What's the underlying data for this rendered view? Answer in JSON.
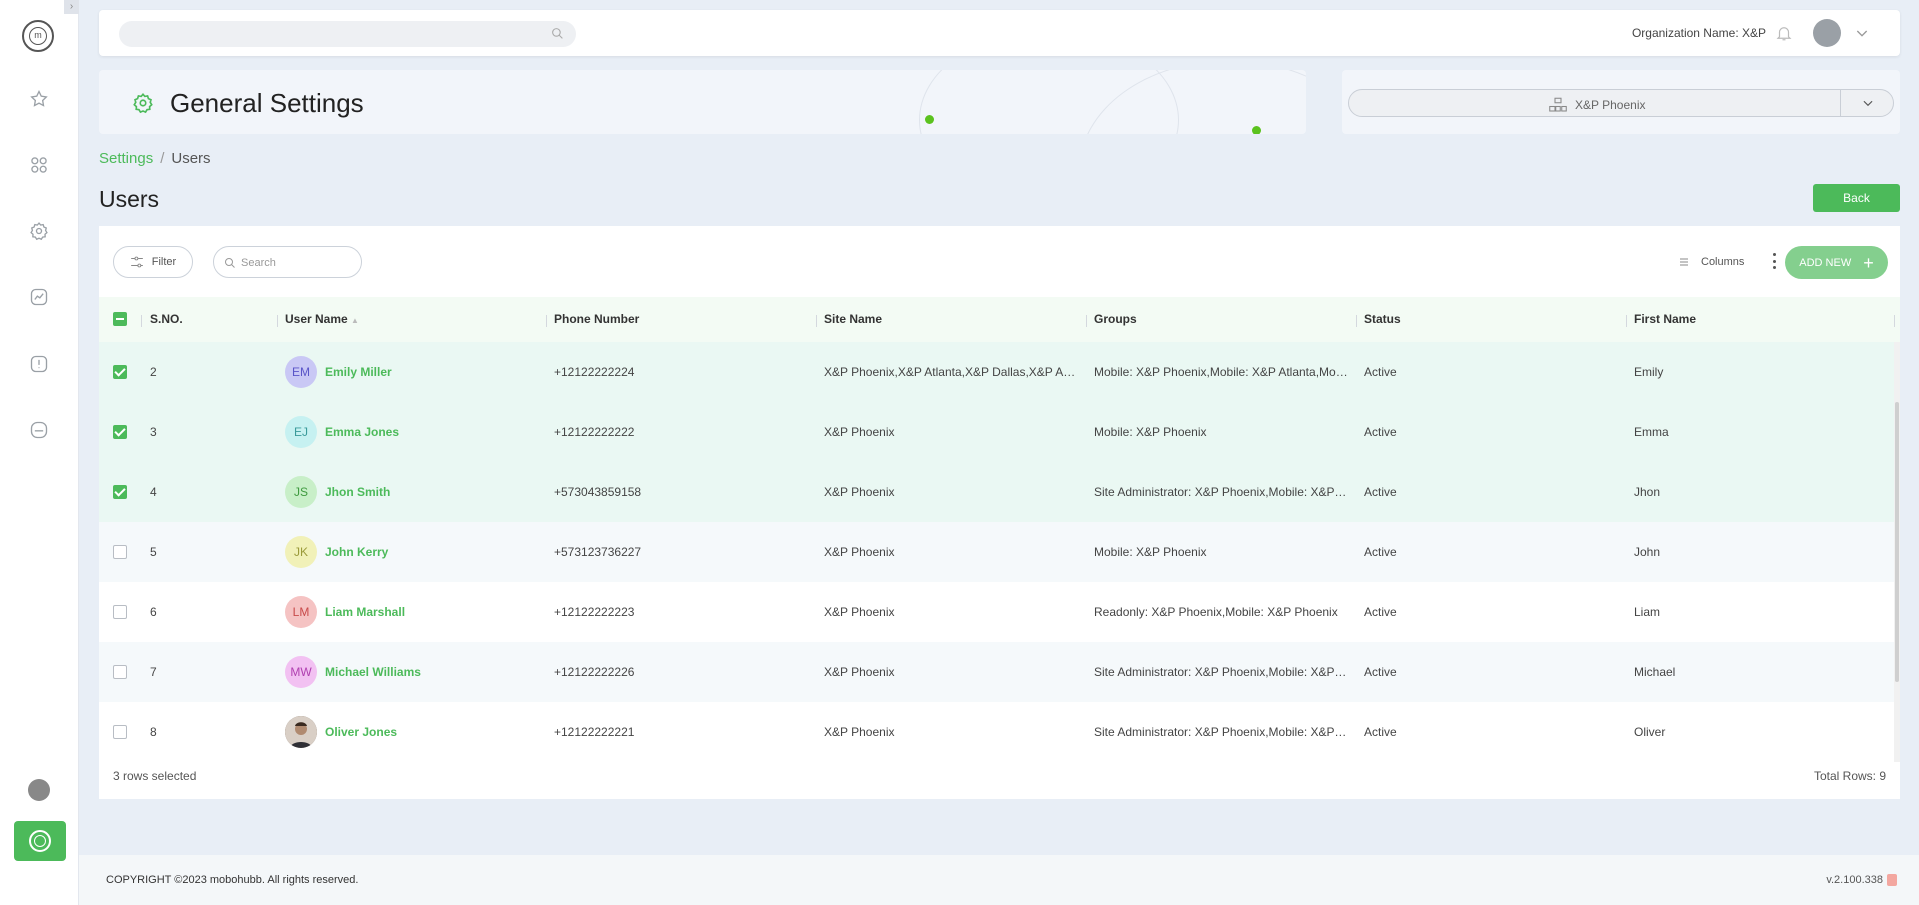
{
  "header": {
    "title": "General Settings",
    "org_label": "Organization Name: X&P",
    "site_selected": "X&P Phoenix"
  },
  "breadcrumb": {
    "parent": "Settings",
    "separator": "/",
    "current": "Users"
  },
  "page": {
    "title": "Users",
    "back_label": "Back"
  },
  "toolbar": {
    "filter_label": "Filter",
    "search_placeholder": "Search",
    "columns_label": "Columns",
    "add_label": "ADD NEW"
  },
  "table": {
    "columns": [
      "S.NO.",
      "User Name",
      "Phone Number",
      "Site Name",
      "Groups",
      "Status",
      "First Name"
    ],
    "rows": [
      {
        "sno": "2",
        "initials": "EM",
        "name": "Emily Miller",
        "phone": "+12122222224",
        "site": "X&P Phoenix,X&P Atlanta,X&P Dallas,X&P Austin",
        "groups": "Mobile: X&P Phoenix,Mobile: X&P Atlanta,Mobil...",
        "status": "Active",
        "first": "Emily",
        "selected": true
      },
      {
        "sno": "3",
        "initials": "EJ",
        "name": "Emma Jones",
        "phone": "+12122222222",
        "site": "X&P Phoenix",
        "groups": "Mobile: X&P Phoenix",
        "status": "Active",
        "first": "Emma",
        "selected": true
      },
      {
        "sno": "4",
        "initials": "JS",
        "name": "Jhon Smith",
        "phone": "+573043859158",
        "site": "X&P Phoenix",
        "groups": "Site Administrator: X&P Phoenix,Mobile: X&P P...",
        "status": "Active",
        "first": "Jhon",
        "selected": true
      },
      {
        "sno": "5",
        "initials": "JK",
        "name": "John Kerry",
        "phone": "+573123736227",
        "site": "X&P Phoenix",
        "groups": "Mobile: X&P Phoenix",
        "status": "Active",
        "first": "John",
        "selected": false
      },
      {
        "sno": "6",
        "initials": "LM",
        "name": "Liam Marshall",
        "phone": "+12122222223",
        "site": "X&P Phoenix",
        "groups": "Readonly: X&P Phoenix,Mobile: X&P Phoenix",
        "status": "Active",
        "first": "Liam",
        "selected": false
      },
      {
        "sno": "7",
        "initials": "MW",
        "name": "Michael Williams",
        "phone": "+12122222226",
        "site": "X&P Phoenix",
        "groups": "Site Administrator: X&P Phoenix,Mobile: X&P P...",
        "status": "Active",
        "first": "Michael",
        "selected": false
      },
      {
        "sno": "8",
        "initials": "",
        "name": "Oliver Jones",
        "phone": "+12122222221",
        "site": "X&P Phoenix",
        "groups": "Site Administrator: X&P Phoenix,Mobile: X&P P...",
        "status": "Active",
        "first": "Oliver",
        "selected": false
      }
    ],
    "avatar_colors": [
      {
        "bg": "#c9c8f5",
        "fg": "#5a55c8"
      },
      {
        "bg": "#c6f1f1",
        "fg": "#3a9a9a"
      },
      {
        "bg": "#c8efc8",
        "fg": "#3f9a3f"
      },
      {
        "bg": "#f1f1b8",
        "fg": "#9a9a3a"
      },
      {
        "bg": "#f5c3c3",
        "fg": "#c84a4a"
      },
      {
        "bg": "#f2c1f2",
        "fg": "#b03fb0"
      },
      {
        "bg": "#6b5a4e",
        "fg": "#ffffff"
      }
    ],
    "selection_status": "3 rows selected",
    "total_rows": "Total Rows: 9"
  },
  "footer": {
    "copyright": "COPYRIGHT ©2023 mobohubb. All rights reserved.",
    "version": "v.2.100.338"
  },
  "colors": {
    "accent": "#4cba5a",
    "background": "#e8eef6"
  }
}
